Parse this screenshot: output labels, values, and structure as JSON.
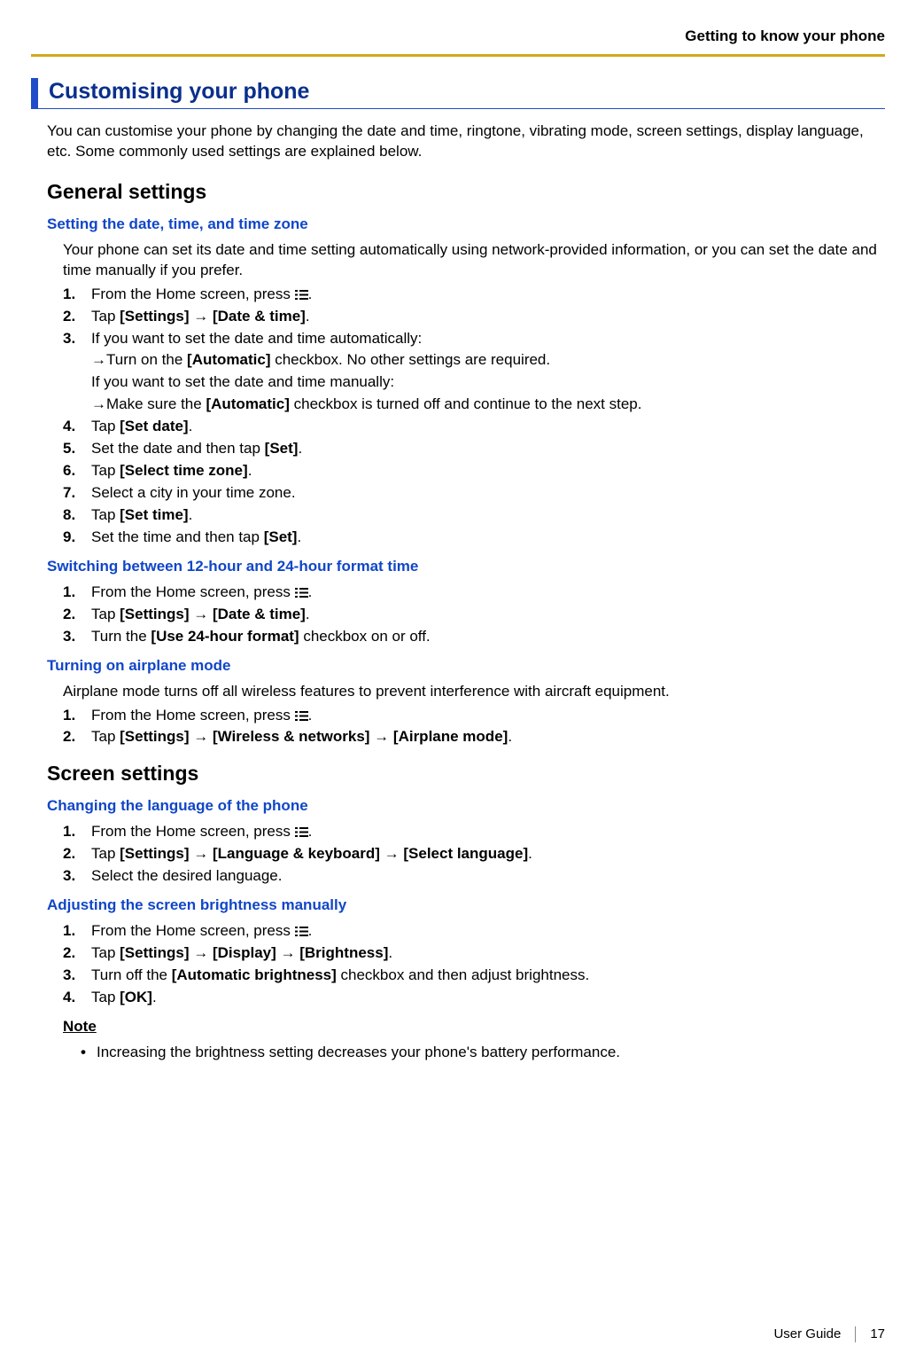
{
  "header": {
    "chapter": "Getting to know your phone"
  },
  "title": "Customising your phone",
  "intro": "You can customise your phone by changing the date and time, ringtone, vibrating mode, screen settings, display language, etc. Some commonly used settings are explained below.",
  "sec1": {
    "title": "General settings",
    "sub1": {
      "title": "Setting the date, time, and time zone",
      "lead": "Your phone can set its date and time setting automatically using network-provided information, or you can set the date and time manually if you prefer.",
      "s1a": "From the Home screen, press ",
      "s1b": ".",
      "s2a": "Tap ",
      "s2b": "[Settings]",
      "s2c": " → ",
      "s2d": "[Date & time]",
      "s2e": ".",
      "s3a": "If you want to set the date and time automatically:",
      "s3b": "→Turn on the ",
      "s3c": "[Automatic]",
      "s3d": " checkbox. No other settings are required.",
      "s3e": "If you want to set the date and time manually:",
      "s3f": "→Make sure the ",
      "s3g": "[Automatic]",
      "s3h": " checkbox is turned off and continue to the next step.",
      "s4a": "Tap ",
      "s4b": "[Set date]",
      "s4c": ".",
      "s5a": "Set the date and then tap ",
      "s5b": "[Set]",
      "s5c": ".",
      "s6a": "Tap ",
      "s6b": "[Select time zone]",
      "s6c": ".",
      "s7": "Select a city in your time zone.",
      "s8a": "Tap ",
      "s8b": "[Set time]",
      "s8c": ".",
      "s9a": "Set the time and then tap ",
      "s9b": "[Set]",
      "s9c": "."
    },
    "sub2": {
      "title": "Switching between 12-hour and 24-hour format time",
      "s1a": "From the Home screen, press ",
      "s1b": ".",
      "s2a": "Tap ",
      "s2b": "[Settings]",
      "s2c": " → ",
      "s2d": "[Date & time]",
      "s2e": ".",
      "s3a": "Turn the ",
      "s3b": "[Use 24-hour format]",
      "s3c": " checkbox on or off."
    },
    "sub3": {
      "title": "Turning on airplane mode",
      "lead": "Airplane mode turns off all wireless features to prevent interference with aircraft equipment.",
      "s1a": "From the Home screen, press ",
      "s1b": ".",
      "s2a": "Tap ",
      "s2b": "[Settings]",
      "s2c": " → ",
      "s2d": "[Wireless & networks]",
      "s2e": " → ",
      "s2f": "[Airplane mode]",
      "s2g": "."
    }
  },
  "sec2": {
    "title": "Screen settings",
    "sub1": {
      "title": "Changing the language of the phone",
      "s1a": "From the Home screen, press ",
      "s1b": ".",
      "s2a": "Tap ",
      "s2b": "[Settings]",
      "s2c": " → ",
      "s2d": "[Language & keyboard]",
      "s2e": " → ",
      "s2f": "[Select language]",
      "s2g": ".",
      "s3": "Select the desired language."
    },
    "sub2": {
      "title": "Adjusting the screen brightness manually",
      "s1a": "From the Home screen, press ",
      "s1b": ".",
      "s2a": "Tap ",
      "s2b": "[Settings]",
      "s2c": " → ",
      "s2d": "[Display]",
      "s2e": " → ",
      "s2f": "[Brightness]",
      "s2g": ".",
      "s3a": "Turn off the ",
      "s3b": "[Automatic brightness]",
      "s3c": " checkbox and then adjust brightness.",
      "s4a": "Tap ",
      "s4b": "[OK]",
      "s4c": "."
    }
  },
  "note": {
    "title": "Note",
    "item": "Increasing the brightness setting decreases your phone's battery performance."
  },
  "footer": {
    "label": "User Guide",
    "page": "17"
  }
}
